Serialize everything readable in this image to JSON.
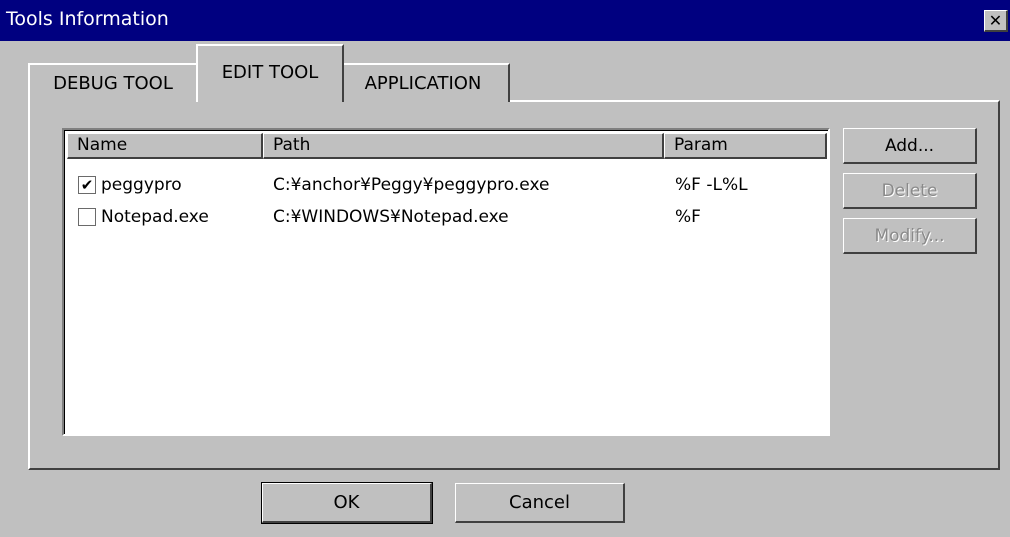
{
  "window": {
    "title": "Tools Information",
    "close_glyph": "✕"
  },
  "tabs": [
    {
      "label": "DEBUG TOOL",
      "active": false
    },
    {
      "label": "EDIT TOOL",
      "active": true
    },
    {
      "label": "APPLICATION",
      "active": false
    }
  ],
  "table": {
    "columns": [
      "Name",
      "Path",
      "Param"
    ],
    "rows": [
      {
        "checked": true,
        "name": "peggypro",
        "path": "C:¥anchor¥Peggy¥peggypro.exe",
        "param": "%F -L%L"
      },
      {
        "checked": false,
        "name": "Notepad.exe",
        "path": "C:¥WINDOWS¥Notepad.exe",
        "param": "%F"
      }
    ]
  },
  "side_buttons": {
    "add": {
      "label": "Add...",
      "enabled": true
    },
    "delete": {
      "label": "Delete",
      "enabled": false
    },
    "modify": {
      "label": "Modify...",
      "enabled": false
    }
  },
  "dialog_buttons": {
    "ok": "OK",
    "cancel": "Cancel"
  },
  "check_glyph": "✔",
  "colors": {
    "titlebar": "#000080",
    "face": "#c0c0c0",
    "list_bg": "#ffffff",
    "disabled_text": "#8a8a8a"
  }
}
